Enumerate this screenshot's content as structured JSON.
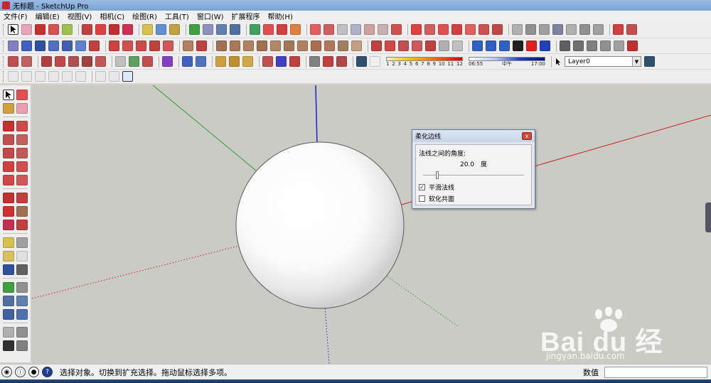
{
  "window": {
    "title": "无标题 - SketchUp Pro"
  },
  "menu": [
    "文件(F)",
    "编辑(E)",
    "视图(V)",
    "相机(C)",
    "绘图(R)",
    "工具(T)",
    "窗口(W)",
    "扩展程序",
    "帮助(H)"
  ],
  "toolbar": {
    "shadow_months": [
      "1",
      "2",
      "3",
      "4",
      "5",
      "6",
      "7",
      "8",
      "9",
      "10",
      "11",
      "12"
    ],
    "shadow_time": {
      "start": "06:55",
      "mid": "中午",
      "end": "17:00"
    },
    "layer": "Layer0",
    "icons": [
      "select-icon",
      "eraser-icon",
      "pencil-icon",
      "rectangle-icon",
      "circle-icon",
      "pushpull-icon",
      "move-icon",
      "rotate-icon",
      "scale-icon",
      "tape-icon",
      "text-icon",
      "paint-icon",
      "orbit-icon",
      "pan-icon",
      "zoom-icon",
      "zoom-extents-icon",
      "components-icon",
      "materials-icon",
      "styles-icon",
      "layers-icon",
      "scenes-icon",
      "shadows-icon",
      "fog-icon",
      "sandbox-icon"
    ]
  },
  "dialog": {
    "title": "柔化边线",
    "angle_label": "法线之间的角度:",
    "angle_value": "20.0",
    "angle_unit": "度",
    "smooth_normals_label": "平滑法线",
    "smooth_normals_checked": true,
    "soften_coplanar_label": "软化共面",
    "soften_coplanar_checked": false,
    "close_glyph": "x"
  },
  "status": {
    "message": "选择对象。切换到扩充选择。拖动鼠标选择多项。",
    "measure_label": "数值",
    "measure_value": ""
  },
  "watermark": {
    "text": "Bai du 经验",
    "url": "jingyan.baidu.com"
  },
  "colors": {
    "viewport_bg": "#cbcbc5",
    "axis_red": "#cc2020",
    "axis_green": "#2c9a2c",
    "axis_blue": "#2020c0"
  }
}
